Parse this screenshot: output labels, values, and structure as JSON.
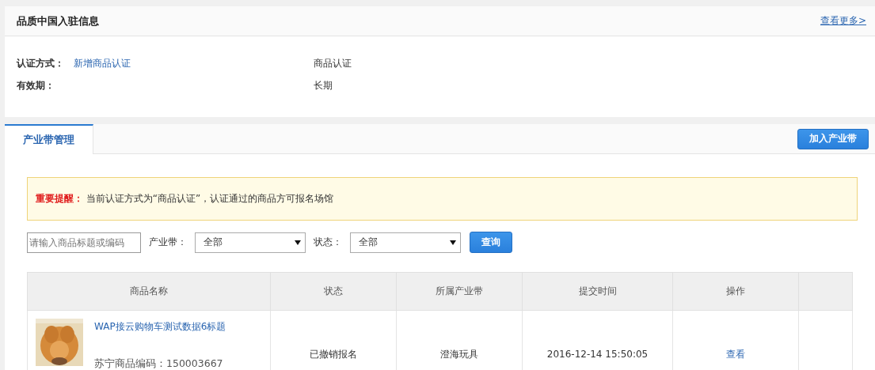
{
  "info_panel": {
    "title": "品质中国入驻信息",
    "more_link": "查看更多>",
    "fields": [
      {
        "label": "认证方式：",
        "link": "新增商品认证",
        "value": "商品认证"
      },
      {
        "label": "有效期：",
        "value": "长期"
      }
    ]
  },
  "tabs": [
    {
      "label": "产业带管理",
      "selected": true
    }
  ],
  "join_button": "加入产业带",
  "notice": {
    "label": "重要提醒：",
    "text": "当前认证方式为“商品认证”，认证通过的商品方可报名场馆"
  },
  "filters": {
    "search": {
      "placeholder": "请输入商品标题或编码"
    },
    "dropdowns": [
      {
        "label": "产业带：",
        "value": "全部"
      },
      {
        "label": "状态：",
        "value": "全部"
      }
    ],
    "query_button": "查询"
  },
  "table": {
    "columns": [
      "商品名称",
      "状态",
      "所属产业带",
      "提交时间",
      "操作"
    ],
    "rows": [
      {
        "title": "WAP接云购物车测试数据6标题",
        "code": "苏宁商品编码：150003667",
        "status": "已撤销报名",
        "industry": "澄海玩具",
        "time": "2016-12-14 15:50:05",
        "action": "查看"
      }
    ]
  }
}
